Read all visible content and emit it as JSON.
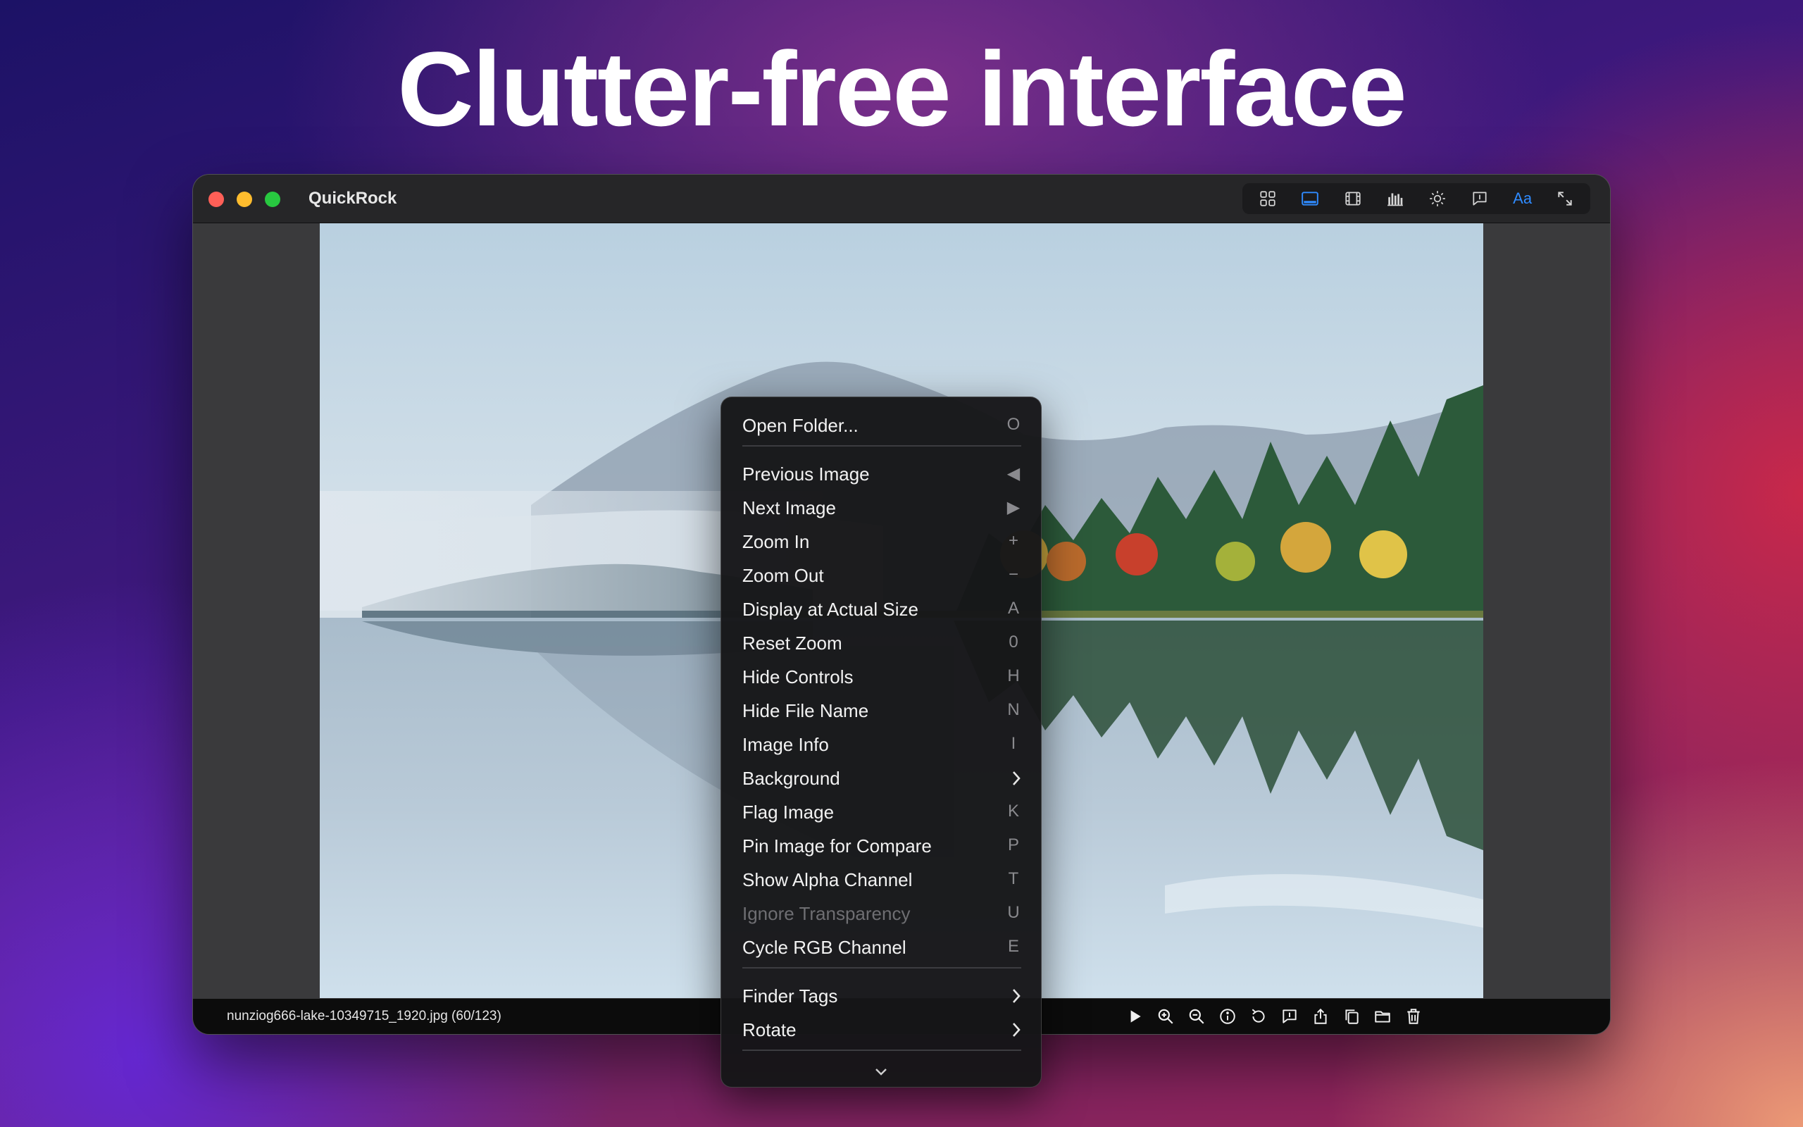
{
  "headline": "Clutter-free interface",
  "window": {
    "title": "QuickRock",
    "toolbar": [
      {
        "icon": "grid-icon"
      },
      {
        "icon": "filmstrip-panel-icon",
        "active": true
      },
      {
        "icon": "film-icon"
      },
      {
        "icon": "histogram-icon"
      },
      {
        "icon": "brightness-icon"
      },
      {
        "icon": "info-bubble-icon"
      },
      {
        "icon": "font-icon",
        "label": "Aa"
      },
      {
        "icon": "fullscreen-icon"
      }
    ]
  },
  "status": {
    "filename": "nunziog666-lake-10349715_1920.jpg (60/123)",
    "icons": [
      "play-icon",
      "zoom-in-icon",
      "zoom-out-icon",
      "info-icon",
      "rotate-icon",
      "comment-icon",
      "share-icon",
      "copy-icon",
      "folder-icon",
      "trash-icon"
    ]
  },
  "menu": {
    "items": [
      {
        "label": "Open Folder...",
        "key": "O"
      },
      {
        "label": "Previous Image",
        "key": "◀"
      },
      {
        "label": "Next Image",
        "key": "▶"
      },
      {
        "label": "Zoom In",
        "key": "+"
      },
      {
        "label": "Zoom Out",
        "key": "−"
      },
      {
        "label": "Display at Actual Size",
        "key": "A"
      },
      {
        "label": "Reset Zoom",
        "key": "0"
      },
      {
        "label": "Hide Controls",
        "key": "H"
      },
      {
        "label": "Hide File Name",
        "key": "N"
      },
      {
        "label": "Image Info",
        "key": "I"
      },
      {
        "label": "Background",
        "submenu": true
      },
      {
        "label": "Flag Image",
        "key": "K"
      },
      {
        "label": "Pin Image for Compare",
        "key": "P"
      },
      {
        "label": "Show Alpha Channel",
        "key": "T"
      },
      {
        "label": "Ignore Transparency",
        "key": "U",
        "disabled": true
      },
      {
        "label": "Cycle RGB Channel",
        "key": "E"
      },
      {
        "label": "Finder Tags",
        "submenu": true
      },
      {
        "label": "Rotate",
        "submenu": true
      }
    ],
    "more_icon": "chevron-down-icon"
  },
  "colors": {
    "accent": "#2f8bff",
    "close": "#ff5f57",
    "minimize": "#febc2e",
    "zoom": "#28c840"
  }
}
